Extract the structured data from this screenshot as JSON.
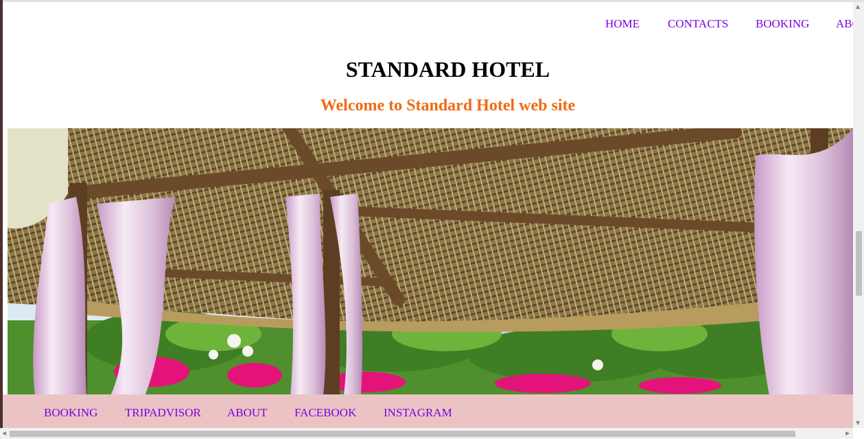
{
  "top_nav": {
    "items": [
      {
        "label": "HOME"
      },
      {
        "label": "CONTACTS"
      },
      {
        "label": "BOOKING"
      },
      {
        "label": "ABOUT"
      }
    ]
  },
  "header": {
    "title": "STANDARD HOTEL",
    "subtitle": "Welcome to Standard Hotel web site"
  },
  "hero": {
    "alt": "Thatched roof gazebo with white curtains and tropical garden"
  },
  "bottom_nav": {
    "items": [
      {
        "label": "BOOKING"
      },
      {
        "label": "TRIPADVISOR"
      },
      {
        "label": "ABOUT"
      },
      {
        "label": "FACEBOOK"
      },
      {
        "label": "INSTAGRAM"
      }
    ]
  },
  "colors": {
    "link": "#7b00e0",
    "subtitle": "#f06a14",
    "footer_bg": "#ecc3c5"
  }
}
